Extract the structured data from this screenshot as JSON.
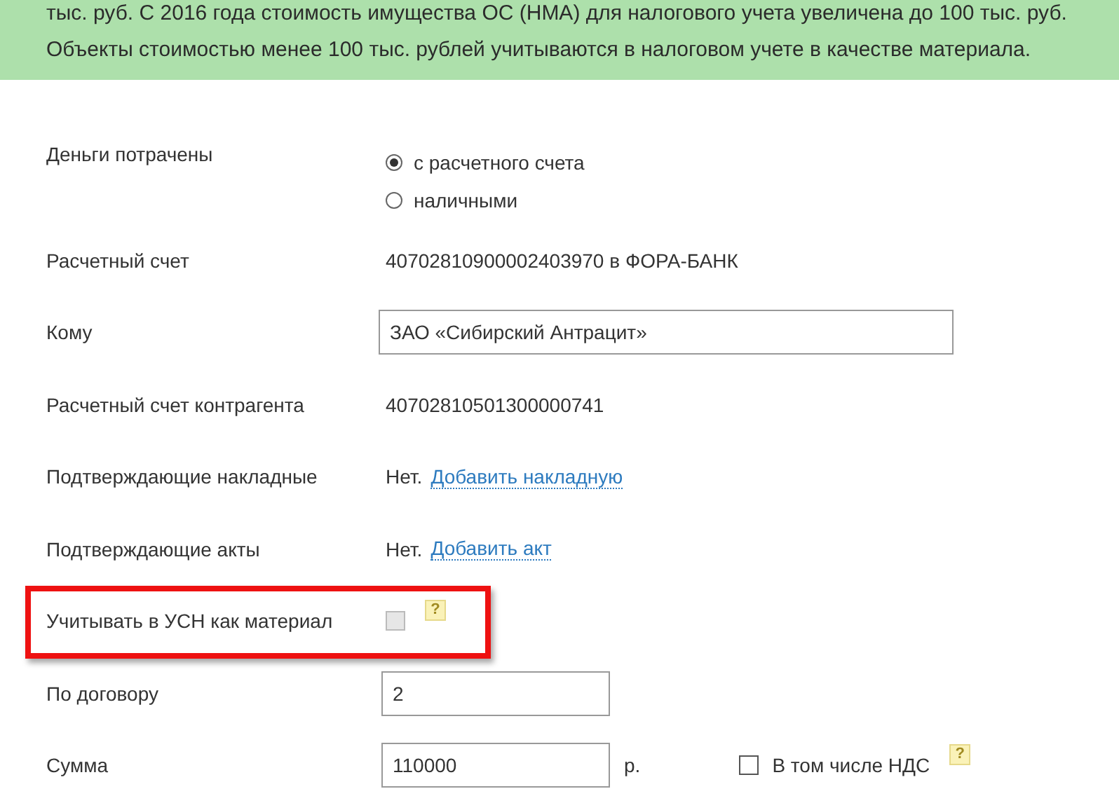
{
  "banner": {
    "lines": [
      "тыс. руб. С 2016 года стоимость имущества ОС (НМА) для налогового учета увеличена до 100 тыс. руб.",
      "Объекты стоимостью менее 100 тыс. рублей учитываются в налоговом учете в качестве материала."
    ]
  },
  "fields": [
    {
      "kind": "radio",
      "label": "Деньги потрачены",
      "options": [
        {
          "label": "с расчетного счета",
          "selected": true
        },
        {
          "label": "наличными",
          "selected": false
        }
      ]
    },
    {
      "kind": "text",
      "label": "Расчетный счет",
      "value": "40702810900002403970 в ФОРА-БАНК"
    },
    {
      "kind": "input",
      "label": "Кому",
      "value": "ЗАО «Сибирский Антрацит»",
      "wide": true
    },
    {
      "kind": "text",
      "label": "Расчетный счет контрагента",
      "value": "40702810501300000741"
    },
    {
      "kind": "link",
      "label": "Подтверждающие накладные",
      "value": "Нет.",
      "link": "Добавить накладную"
    },
    {
      "kind": "link",
      "label": "Подтверждающие акты",
      "value": "Нет.",
      "link": "Добавить акт"
    },
    {
      "kind": "checkbox",
      "label": "Учитывать в УСН как материал",
      "checked": false,
      "disabled": true,
      "help": "?",
      "highlighted": true
    },
    {
      "kind": "input",
      "label": "По договору",
      "value": "2",
      "wide": false
    },
    {
      "kind": "money",
      "label": "Сумма",
      "value": "110000",
      "unit": "р.",
      "vat": {
        "label": "В том числе НДС",
        "checked": false,
        "help": "?"
      }
    }
  ]
}
